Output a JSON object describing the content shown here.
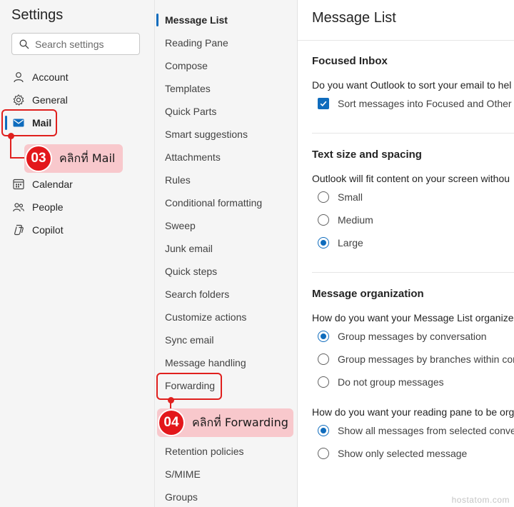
{
  "settings": {
    "title": "Settings",
    "search_placeholder": "Search settings",
    "nav": [
      {
        "label": "Account",
        "icon": "person-icon"
      },
      {
        "label": "General",
        "icon": "gear-icon"
      },
      {
        "label": "Mail",
        "icon": "mail-icon"
      },
      {
        "label": "Calendar",
        "icon": "calendar-icon"
      },
      {
        "label": "People",
        "icon": "people-icon"
      },
      {
        "label": "Copilot",
        "icon": "copilot-icon"
      }
    ],
    "active": "Mail"
  },
  "mail_menu": {
    "items": [
      "Message List",
      "Reading Pane",
      "Compose",
      "Templates",
      "Quick Parts",
      "Smart suggestions",
      "Attachments",
      "Rules",
      "Conditional formatting",
      "Sweep",
      "Junk email",
      "Quick steps",
      "Search folders",
      "Customize actions",
      "Sync email",
      "Message handling",
      "Forwarding",
      "Retention policies",
      "S/MIME",
      "Groups"
    ],
    "selected": "Message List"
  },
  "panel": {
    "title": "Message List",
    "focused": {
      "heading": "Focused Inbox",
      "desc": "Do you want Outlook to sort your email to hel",
      "checkbox": "Sort messages into Focused and Other"
    },
    "text_size": {
      "heading": "Text size and spacing",
      "desc": "Outlook will fit content on your screen withou",
      "options": [
        "Small",
        "Medium",
        "Large"
      ],
      "selected": "Large"
    },
    "organization": {
      "heading": "Message organization",
      "desc": "How do you want your Message List organized",
      "options": [
        "Group messages by conversation",
        "Group messages by branches within con",
        "Do not group messages"
      ],
      "selected": "Group messages by conversation",
      "reading_desc": "How do you want your reading pane to be org",
      "reading_options": [
        "Show all messages from selected conver",
        "Show only selected message"
      ],
      "reading_selected": "Show all messages from selected conver"
    }
  },
  "annotations": {
    "step3": {
      "number": "03",
      "text": "คลิกที่ Mail"
    },
    "step4": {
      "number": "04",
      "text": "คลิกที่ Forwarding"
    }
  },
  "watermark": "hostatom.com",
  "colors": {
    "accent": "#0f6cbd",
    "annotation": "#e0201e",
    "callout_bg": "#f8c8cc"
  }
}
